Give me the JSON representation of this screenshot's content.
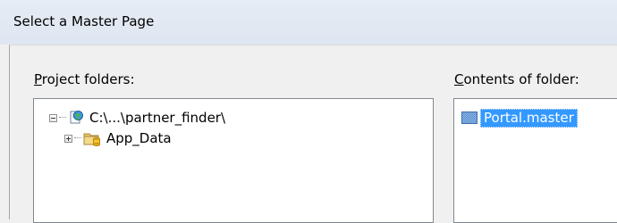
{
  "dialog": {
    "title": "Select a Master Page"
  },
  "left_pane": {
    "label_accesskey": "P",
    "label_rest": "roject folders:",
    "tree": [
      {
        "label": "C:\\...\\partner_finder\\",
        "icon": "web-project-icon",
        "expander": "collapse",
        "level": 0
      },
      {
        "label": "App_Data",
        "icon": "data-folder-icon",
        "expander": "expand",
        "level": 1
      }
    ]
  },
  "right_pane": {
    "label_accesskey": "C",
    "label_rest": "ontents of folder:",
    "files": [
      {
        "name": "Portal.master",
        "icon": "master-page-icon",
        "selected": true
      }
    ]
  },
  "colors": {
    "selection": "#3399ff",
    "title_bar": "#e6ecf5",
    "dialog_bg": "#f0f0f0"
  }
}
